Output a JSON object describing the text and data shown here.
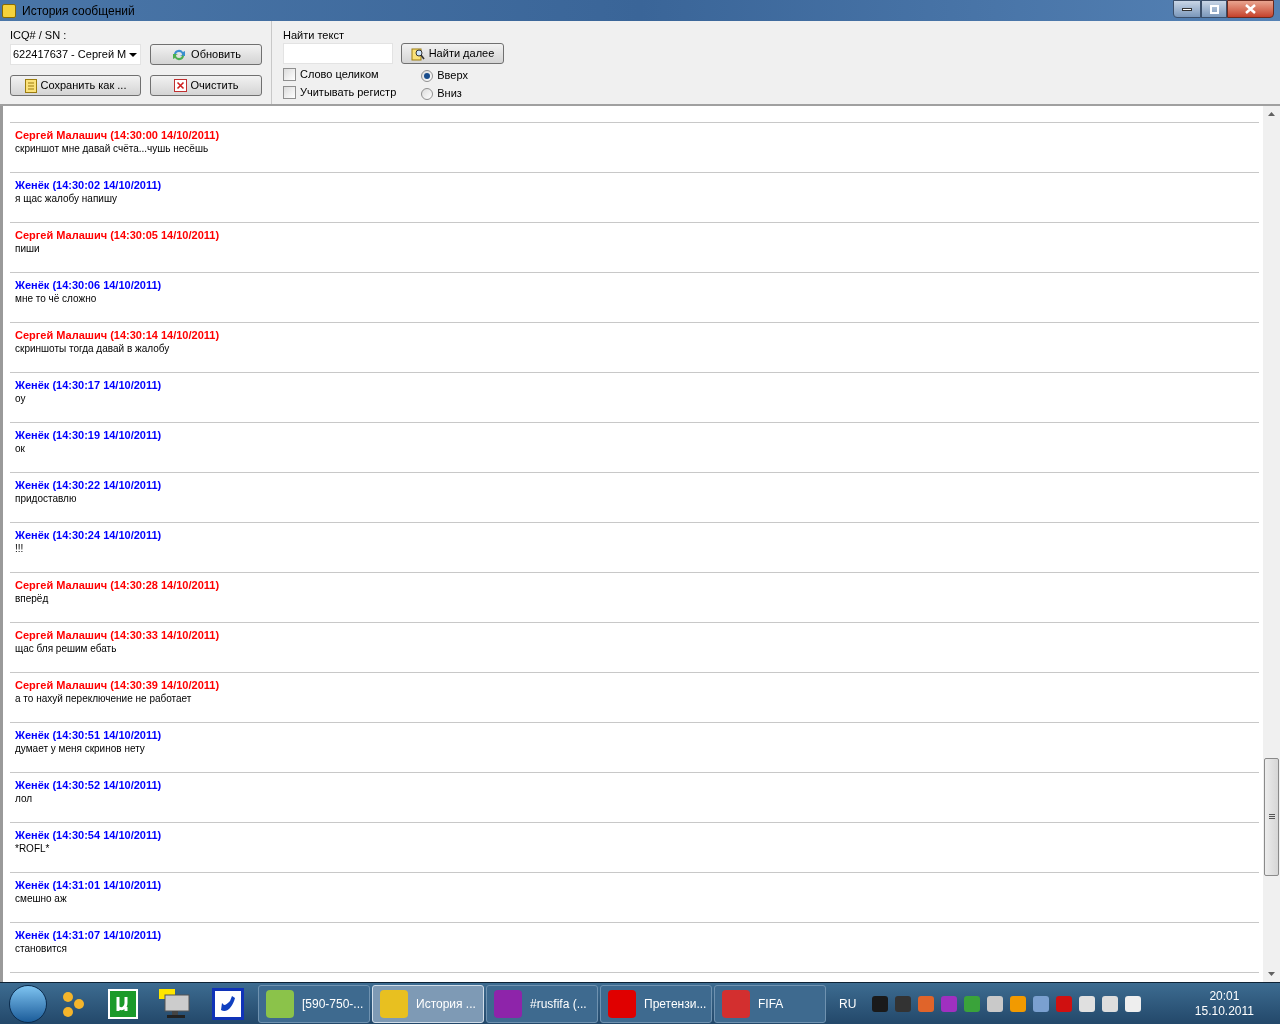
{
  "window": {
    "title": "История сообщений"
  },
  "toolbar": {
    "contact_label": "ICQ# / SN :",
    "contact_value": "622417637 - Сергей М",
    "refresh_button": "Обновить",
    "save_button": "Сохранить как ...",
    "clear_button": "Очистить",
    "find_label": "Найти текст",
    "find_button": "Найти далее",
    "options": [
      {
        "label": "Слово целиком",
        "checked": false
      },
      {
        "label": "Учитывать регистр",
        "checked": false
      }
    ],
    "direction": [
      {
        "label": "Вверх",
        "selected": true
      },
      {
        "label": "Вниз",
        "selected": false
      }
    ]
  },
  "messages": [
    {
      "header": "Сергей Малашич (14:30:00 14/10/2011)",
      "text": "скриншот мне давай счёта...чушь несёшь",
      "color": "#ff0000"
    },
    {
      "header": "Женёк (14:30:02 14/10/2011)",
      "text": "я щас жалобу напишу",
      "color": "#0000ff"
    },
    {
      "header": "Сергей Малашич (14:30:05 14/10/2011)",
      "text": "пиши",
      "color": "#ff0000"
    },
    {
      "header": "Женёк (14:30:06 14/10/2011)",
      "text": "мне то чё сложно",
      "color": "#0000ff"
    },
    {
      "header": "Сергей Малашич (14:30:14 14/10/2011)",
      "text": "скриншоты тогда давай в жалобу",
      "color": "#ff0000"
    },
    {
      "header": "Женёк (14:30:17 14/10/2011)",
      "text": "оу",
      "color": "#0000ff"
    },
    {
      "header": "Женёк (14:30:19 14/10/2011)",
      "text": "ок",
      "color": "#0000ff"
    },
    {
      "header": "Женёк (14:30:22 14/10/2011)",
      "text": "придоставлю",
      "color": "#0000ff"
    },
    {
      "header": "Женёк (14:30:24 14/10/2011)",
      "text": "!!!",
      "color": "#0000ff"
    },
    {
      "header": "Сергей Малашич (14:30:28 14/10/2011)",
      "text": "вперёд",
      "color": "#ff0000"
    },
    {
      "header": "Сергей Малашич (14:30:33 14/10/2011)",
      "text": "щас бля решим ебать",
      "color": "#ff0000"
    },
    {
      "header": "Сергей Малашич (14:30:39 14/10/2011)",
      "text": "а то нахуй переключение не работает",
      "color": "#ff0000"
    },
    {
      "header": "Женёк (14:30:51 14/10/2011)",
      "text": "думает у меня скринов нету",
      "color": "#0000ff"
    },
    {
      "header": "Женёк (14:30:52 14/10/2011)",
      "text": "лол",
      "color": "#0000ff"
    },
    {
      "header": "Женёк (14:30:54 14/10/2011)",
      "text": "*ROFL*",
      "color": "#0000ff"
    },
    {
      "header": "Женёк (14:31:01 14/10/2011)",
      "text": "смешно аж",
      "color": "#0000ff"
    },
    {
      "header": "Женёк (14:31:07 14/10/2011)",
      "text": "становится",
      "color": "#0000ff"
    }
  ],
  "taskbar": {
    "tasks": [
      {
        "label": "[590-750-...",
        "selected": false,
        "color": "#8bc34a"
      },
      {
        "label": "История ...",
        "selected": true,
        "color": "#e8c020"
      },
      {
        "label": "#rusfifa (...",
        "selected": false,
        "color": "#8e24aa"
      },
      {
        "label": "Претензи...",
        "selected": false,
        "color": "#e00000"
      },
      {
        "label": "FIFA",
        "selected": false,
        "color": "#d32f2f"
      }
    ],
    "language": "RU",
    "time": "20:01",
    "date": "15.10.2011"
  }
}
